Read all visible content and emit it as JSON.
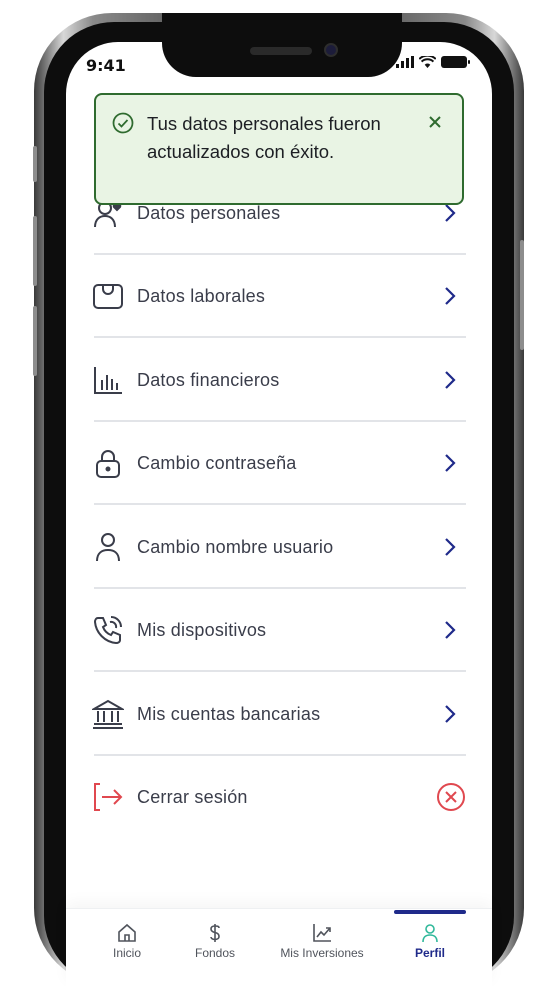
{
  "status_bar": {
    "time": "9:41"
  },
  "toast": {
    "message": "Tus datos personales fueron actualizados con éxito.",
    "close_label": "×"
  },
  "menu": {
    "items": [
      {
        "label": "Datos personales",
        "icon": "user-heart-icon"
      },
      {
        "label": "Datos laborales",
        "icon": "briefcase-icon"
      },
      {
        "label": "Datos financieros",
        "icon": "bar-chart-icon"
      },
      {
        "label": "Cambio contraseña",
        "icon": "lock-icon"
      },
      {
        "label": "Cambio nombre usuario",
        "icon": "user-icon"
      },
      {
        "label": "Mis dispositivos",
        "icon": "phone-icon"
      },
      {
        "label": "Mis cuentas bancarias",
        "icon": "bank-icon"
      },
      {
        "label": "Cerrar sesión",
        "icon": "logout-icon"
      }
    ]
  },
  "tabbar": {
    "tabs": [
      {
        "label": "Inicio",
        "icon": "home-icon"
      },
      {
        "label": "Fondos",
        "icon": "dollar-icon"
      },
      {
        "label": "Mis Inversiones",
        "icon": "trend-icon"
      },
      {
        "label": "Perfil",
        "icon": "profile-icon"
      }
    ],
    "active": "Perfil"
  },
  "colors": {
    "toast_bg": "#e9f4e4",
    "toast_border": "#2f6b2f",
    "chevron": "#1f2a8a",
    "logout_red": "#e0484f",
    "active_tab": "#1f2a8a"
  }
}
